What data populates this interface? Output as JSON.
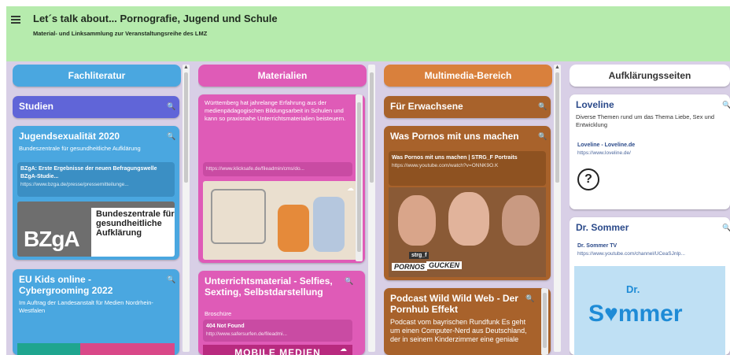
{
  "header": {
    "title": "Let´s talk about... Pornografie, Jugend und Schule",
    "subtitle": "Material- und Linksammlung zur Veranstaltungsreihe des LMZ"
  },
  "columns": [
    {
      "title": "Fachliteratur",
      "cards": [
        {
          "title": "Studien"
        },
        {
          "title": "Jugendsexualität 2020",
          "subtitle": "Bundeszentrale für gesundheitliche Aufklärung",
          "link_title": "BZgA: Erste Ergebnisse der neuen Befragungswelle BZgA-Studie...",
          "link_url": "https://www.bzga.de/presse/pressemitteilunge...",
          "logo_text": "BZgA",
          "logo_caption": "Bundeszentrale für gesundheitliche Aufklärung"
        },
        {
          "title": "EU Kids online - Cybergrooming 2022",
          "subtitle": "Im Auftrag der Landesanstalt für Medien Nordrhein-Westfalen"
        }
      ]
    },
    {
      "title": "Materialien",
      "cards": [
        {
          "text": "Württemberg hat jahrelange Erfahrung aus der medienpädagogischen Bildungsarbeit in Schulen und kann so praxisnahe Unterrichtsmaterialien beisteuern.",
          "link_url": "https://www.klicksafe.de/fileadmin/cms/do..."
        },
        {
          "title": "Unterrichtsmaterial - Selfies, Sexting, Selbstdarstellung",
          "subtitle": "Broschüre",
          "link_title": "404 Not Found",
          "link_url": "http://www.safersurfen.de/fileadmi...",
          "banner_text": "MOBILE MEDIEN"
        }
      ]
    },
    {
      "title": "Multimedia-Bereich",
      "cards": [
        {
          "title": "Für Erwachsene"
        },
        {
          "title": "Was Pornos mit uns machen",
          "link_title": "Was Pornos mit uns machen | STRG_F Portraits",
          "link_url": "https://www.youtube.com/watch?v=ONNK9O.K",
          "video_tags": [
            "strg_f",
            "PORNOS",
            "GUCKEN"
          ]
        },
        {
          "title": "Podcast Wild Wild Web - Der Pornhub Effekt",
          "text": "Podcast vom bayrischen Rundfunk Es geht um einen Computer-Nerd aus Deutschland, der in seinem Kinderzimmer eine geniale"
        }
      ]
    },
    {
      "title": "Aufklärungsseiten",
      "cards": [
        {
          "title": "Loveline",
          "text": "Diverse Themen rund um das Thema Liebe, Sex und Entwicklung",
          "link_title": "Loveline - Loveline.de",
          "link_url": "https://www.loveline.de/"
        },
        {
          "title": "Dr. Sommer",
          "link_title": "Dr. Sommer TV",
          "link_url": "https://www.youtube.com/channel/UCeaSJnlp...",
          "logo_text_a": "S",
          "logo_text_b": "mmer",
          "logo_dr": "Dr."
        }
      ]
    }
  ],
  "icons": {
    "search": "magnifier-icon",
    "upload": "cloud-icon",
    "menu": "hamburger-icon"
  },
  "colors": {
    "header_bg": "#b6ebad",
    "fachliteratur": "#4aa7e0",
    "studien": "#6065d8",
    "materialien": "#df5bb7",
    "multimedia": "#d9803c",
    "multimedia_card": "#a8622b",
    "aufklaerung": "#ffffff"
  }
}
